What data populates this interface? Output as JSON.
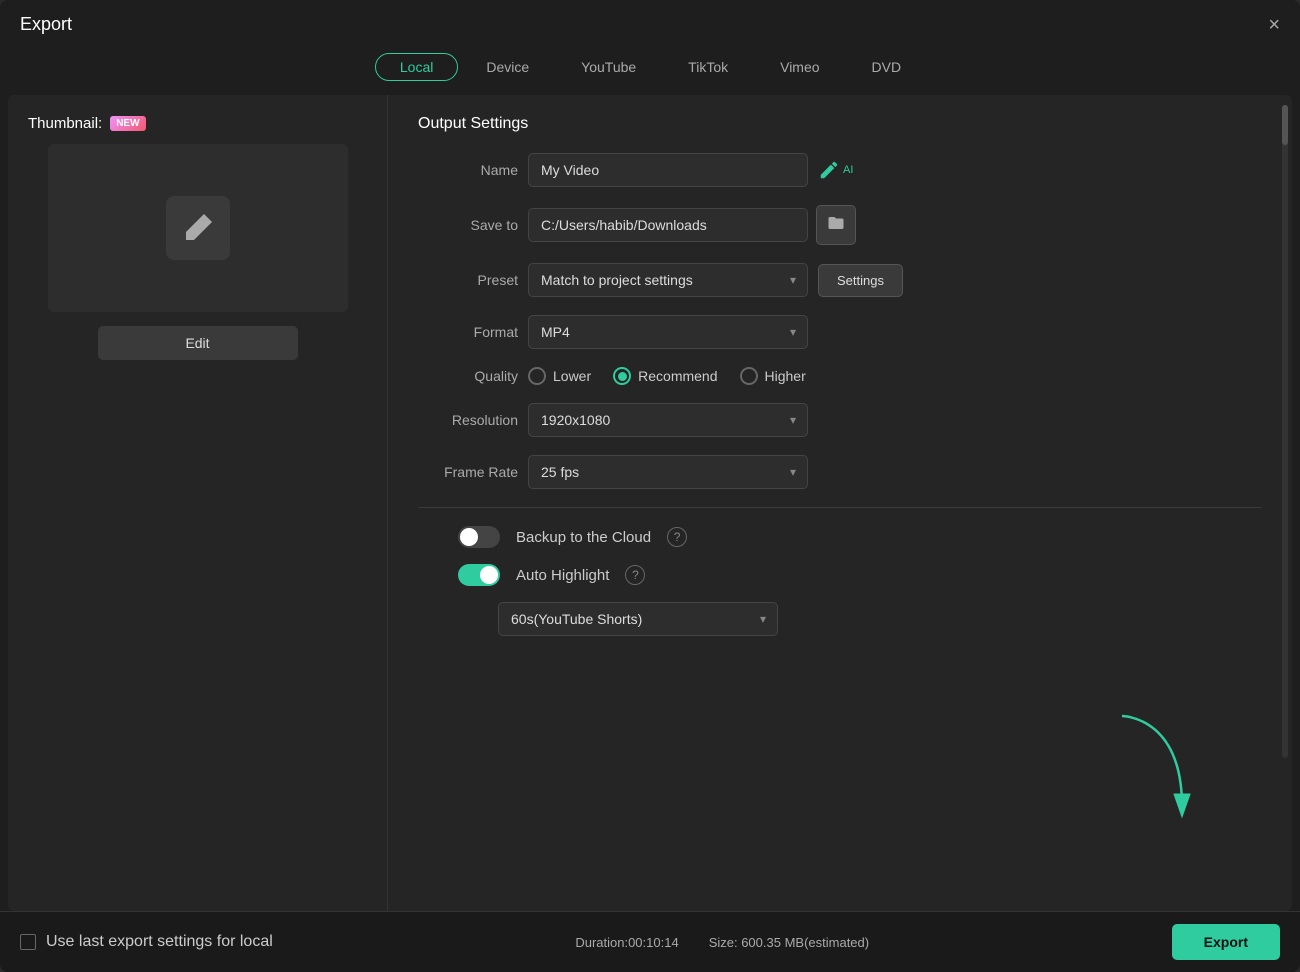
{
  "dialog": {
    "title": "Export",
    "close_label": "×"
  },
  "tabs": [
    {
      "id": "local",
      "label": "Local",
      "active": true
    },
    {
      "id": "device",
      "label": "Device",
      "active": false
    },
    {
      "id": "youtube",
      "label": "YouTube",
      "active": false
    },
    {
      "id": "tiktok",
      "label": "TikTok",
      "active": false
    },
    {
      "id": "vimeo",
      "label": "Vimeo",
      "active": false
    },
    {
      "id": "dvd",
      "label": "DVD",
      "active": false
    }
  ],
  "left_panel": {
    "thumbnail_label": "Thumbnail:",
    "new_badge": "NEW",
    "edit_button": "Edit"
  },
  "output_settings": {
    "section_title": "Output Settings",
    "name_label": "Name",
    "name_value": "My Video",
    "save_to_label": "Save to",
    "save_to_value": "C:/Users/habib/Downloads",
    "preset_label": "Preset",
    "preset_value": "Match to project settings",
    "settings_button": "Settings",
    "format_label": "Format",
    "format_value": "MP4",
    "quality_label": "Quality",
    "quality_options": [
      {
        "id": "lower",
        "label": "Lower",
        "checked": false
      },
      {
        "id": "recommend",
        "label": "Recommend",
        "checked": true
      },
      {
        "id": "higher",
        "label": "Higher",
        "checked": false
      }
    ],
    "resolution_label": "Resolution",
    "resolution_value": "1920x1080",
    "frame_rate_label": "Frame Rate",
    "frame_rate_value": "25 fps",
    "backup_cloud_label": "Backup to the Cloud",
    "backup_cloud_on": false,
    "auto_highlight_label": "Auto Highlight",
    "auto_highlight_on": true,
    "youtube_shorts_value": "60s(YouTube Shorts)"
  },
  "bottom_bar": {
    "checkbox_label": "Use last export settings for local",
    "duration_label": "Duration:00:10:14",
    "size_label": "Size: 600.35 MB(estimated)",
    "export_button": "Export"
  }
}
